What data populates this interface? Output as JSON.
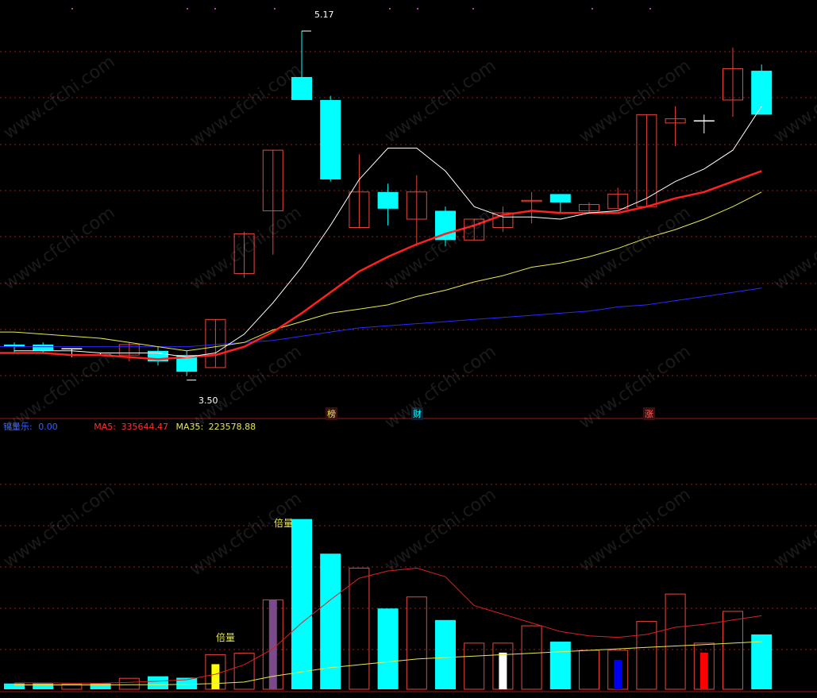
{
  "colors": {
    "up": "#e8453c",
    "down": "#00ffff",
    "ma5": "#ffffff",
    "ma10": "#ff2020",
    "ma20": "#e8e84a",
    "ma60": "#2a2aff",
    "grid": "#9b1a1a",
    "vol_ma5": "#dd2020",
    "vol_ma35": "#e8e84a"
  },
  "price_panel": {
    "high_marker": "5.17",
    "low_marker": "3.50",
    "event_tags": [
      "榜",
      "财",
      "涨"
    ]
  },
  "volume_panel": {
    "header_prefix": "锦量乐:",
    "header_prefix_value": "0.00",
    "ma5_label": "MA5:",
    "ma5_value": "335644.47",
    "ma35_label": "MA35:",
    "ma35_value": "223578.88",
    "annotations": [
      "倍量",
      "倍量"
    ]
  },
  "watermark": "www.cfchi.com",
  "chart_data": [
    {
      "type": "candlestick",
      "ylim": [
        3.4,
        5.25
      ],
      "candles": [
        {
          "o": 3.67,
          "h": 3.68,
          "l": 3.63,
          "c": 3.66,
          "dir": "down"
        },
        {
          "o": 3.67,
          "h": 3.68,
          "l": 3.63,
          "c": 3.64,
          "dir": "down"
        },
        {
          "o": 3.65,
          "h": 3.65,
          "l": 3.61,
          "c": 3.65,
          "dir": "flat"
        },
        {
          "o": 3.62,
          "h": 3.63,
          "l": 3.62,
          "c": 3.62,
          "dir": "flat"
        },
        {
          "o": 3.62,
          "h": 3.68,
          "l": 3.59,
          "c": 3.67,
          "dir": "up"
        },
        {
          "o": 3.64,
          "h": 3.66,
          "l": 3.57,
          "c": 3.59,
          "dir": "down"
        },
        {
          "o": 3.62,
          "h": 3.64,
          "l": 3.52,
          "c": 3.54,
          "dir": "down"
        },
        {
          "o": 3.56,
          "h": 3.79,
          "l": 3.56,
          "c": 3.79,
          "dir": "up"
        },
        {
          "o": 4.01,
          "h": 4.21,
          "l": 3.99,
          "c": 4.2,
          "dir": "up"
        },
        {
          "o": 4.31,
          "h": 4.6,
          "l": 4.1,
          "c": 4.6,
          "dir": "up"
        },
        {
          "o": 4.95,
          "h": 5.17,
          "l": 4.84,
          "c": 4.84,
          "dir": "down"
        },
        {
          "o": 4.84,
          "h": 4.86,
          "l": 4.45,
          "c": 4.46,
          "dir": "down"
        },
        {
          "o": 4.23,
          "h": 4.58,
          "l": 4.23,
          "c": 4.4,
          "dir": "up"
        },
        {
          "o": 4.4,
          "h": 4.44,
          "l": 4.24,
          "c": 4.32,
          "dir": "down"
        },
        {
          "o": 4.27,
          "h": 4.48,
          "l": 4.14,
          "c": 4.4,
          "dir": "up"
        },
        {
          "o": 4.31,
          "h": 4.33,
          "l": 4.14,
          "c": 4.17,
          "dir": "down"
        },
        {
          "o": 4.17,
          "h": 4.27,
          "l": 4.17,
          "c": 4.27,
          "dir": "up"
        },
        {
          "o": 4.23,
          "h": 4.33,
          "l": 4.21,
          "c": 4.3,
          "dir": "up"
        },
        {
          "o": 4.36,
          "h": 4.4,
          "l": 4.25,
          "c": 4.36,
          "dir": "up"
        },
        {
          "o": 4.39,
          "h": 4.39,
          "l": 4.3,
          "c": 4.35,
          "dir": "down"
        },
        {
          "o": 4.31,
          "h": 4.35,
          "l": 4.3,
          "c": 4.34,
          "dir": "up"
        },
        {
          "o": 4.32,
          "h": 4.42,
          "l": 4.32,
          "c": 4.39,
          "dir": "up"
        },
        {
          "o": 4.33,
          "h": 4.77,
          "l": 4.33,
          "c": 4.77,
          "dir": "up"
        },
        {
          "o": 4.73,
          "h": 4.81,
          "l": 4.62,
          "c": 4.75,
          "dir": "up"
        },
        {
          "o": 4.74,
          "h": 4.77,
          "l": 4.68,
          "c": 4.74,
          "dir": "flat"
        },
        {
          "o": 4.84,
          "h": 5.09,
          "l": 4.76,
          "c": 4.99,
          "dir": "up"
        },
        {
          "o": 4.98,
          "h": 5.01,
          "l": 4.77,
          "c": 4.77,
          "dir": "down"
        }
      ],
      "ma5": [
        3.64,
        3.64,
        3.64,
        3.63,
        3.63,
        3.63,
        3.61,
        3.63,
        3.72,
        3.87,
        4.04,
        4.24,
        4.46,
        4.61,
        4.61,
        4.5,
        4.33,
        4.28,
        4.28,
        4.27,
        4.3,
        4.31,
        4.37,
        4.45,
        4.51,
        4.6,
        4.81
      ],
      "ma10": [
        3.63,
        3.63,
        3.62,
        3.62,
        3.61,
        3.6,
        3.61,
        3.62,
        3.66,
        3.73,
        3.82,
        3.92,
        4.02,
        4.09,
        4.15,
        4.2,
        4.24,
        4.29,
        4.31,
        4.3,
        4.3,
        4.3,
        4.33,
        4.37,
        4.4,
        4.45,
        4.5
      ],
      "ma20": [
        3.73,
        3.72,
        3.71,
        3.7,
        3.68,
        3.66,
        3.64,
        3.66,
        3.68,
        3.74,
        3.78,
        3.82,
        3.84,
        3.86,
        3.9,
        3.93,
        3.97,
        4.0,
        4.04,
        4.06,
        4.09,
        4.13,
        4.18,
        4.22,
        4.27,
        4.33,
        4.4
      ],
      "ma60": [
        3.66,
        3.66,
        3.66,
        3.66,
        3.66,
        3.66,
        3.66,
        3.67,
        3.68,
        3.69,
        3.71,
        3.73,
        3.75,
        3.76,
        3.77,
        3.78,
        3.79,
        3.8,
        3.81,
        3.82,
        3.83,
        3.85,
        3.86,
        3.88,
        3.9,
        3.92,
        3.94
      ],
      "high_label": {
        "index": 10,
        "value": 5.17
      },
      "low_label": {
        "index": 6,
        "value": 3.5
      }
    },
    {
      "type": "bar",
      "ylim": [
        0,
        600000
      ],
      "values": [
        20000,
        20000,
        18000,
        20000,
        38000,
        45000,
        40000,
        120000,
        125000,
        310000,
        590000,
        470000,
        420000,
        280000,
        320000,
        240000,
        160000,
        160000,
        220000,
        165000,
        135000,
        135000,
        235000,
        330000,
        160000,
        270000,
        190000
      ],
      "dir": [
        "down",
        "down",
        "up",
        "down",
        "up",
        "down",
        "down",
        "up",
        "up",
        "up",
        "down",
        "down",
        "up",
        "down",
        "up",
        "down",
        "up",
        "up",
        "up",
        "down",
        "up",
        "up",
        "up",
        "up",
        "up",
        "up",
        "down"
      ],
      "marker": [
        {
          "index": 1,
          "color": "#ff22ff"
        },
        {
          "index": 3,
          "color": "#ffffff"
        },
        {
          "index": 7,
          "color": "#ffff00"
        },
        {
          "index": 9,
          "color": "#7a4a8a"
        },
        {
          "index": 17,
          "color": "#ffffff"
        },
        {
          "index": 21,
          "color": "#0000ee"
        },
        {
          "index": 24,
          "color": "#ff0000"
        }
      ],
      "ma5": [
        22000,
        22000,
        21000,
        21000,
        24000,
        28000,
        33000,
        52000,
        85000,
        140000,
        230000,
        310000,
        385000,
        410000,
        420000,
        390000,
        290000,
        260000,
        230000,
        200000,
        185000,
        180000,
        190000,
        215000,
        225000,
        240000,
        255000
      ],
      "ma35": [
        15000,
        15000,
        15000,
        15000,
        16000,
        16000,
        17000,
        20000,
        25000,
        45000,
        60000,
        75000,
        85000,
        95000,
        105000,
        110000,
        115000,
        120000,
        125000,
        130000,
        135000,
        140000,
        145000,
        150000,
        155000,
        160000,
        165000
      ]
    }
  ]
}
